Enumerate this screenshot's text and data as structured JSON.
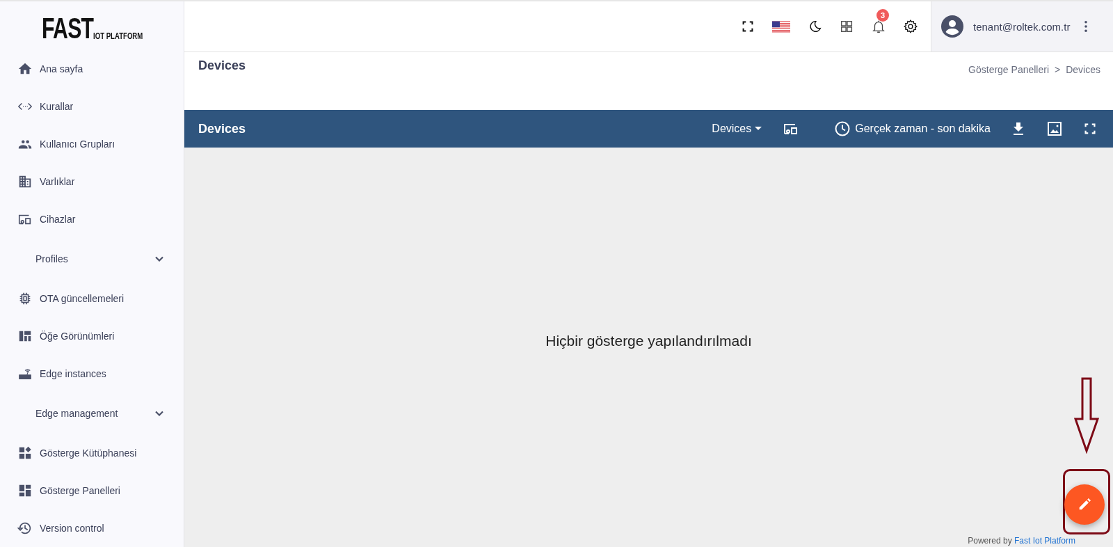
{
  "logo": {
    "title": "FAST",
    "subtitle": "IOT PLATFORM"
  },
  "sidebar": {
    "items": [
      {
        "label": "Ana sayfa",
        "kind": "link"
      },
      {
        "label": "Kurallar",
        "kind": "link"
      },
      {
        "label": "Kullanıcı Grupları",
        "kind": "link"
      },
      {
        "label": "Varlıklar",
        "kind": "link"
      },
      {
        "label": "Cihazlar",
        "kind": "link"
      },
      {
        "label": "Profiles",
        "kind": "group",
        "expanded": false
      },
      {
        "label": "OTA güncellemeleri",
        "kind": "link"
      },
      {
        "label": "Öğe Görünümleri",
        "kind": "link"
      },
      {
        "label": "Edge instances",
        "kind": "link"
      },
      {
        "label": "Edge management",
        "kind": "group",
        "expanded": false
      },
      {
        "label": "Gösterge Kütüphanesi",
        "kind": "link"
      },
      {
        "label": "Gösterge Panelleri",
        "kind": "link"
      },
      {
        "label": "Version control",
        "kind": "link"
      }
    ]
  },
  "topbar": {
    "notifications": {
      "count": "3"
    },
    "user": {
      "email": "tenant@roltek.com.tr"
    }
  },
  "page": {
    "title": "Devices",
    "breadcrumb": [
      "Gösterge Panelleri",
      "Devices"
    ],
    "separator": ">"
  },
  "dashboard_toolbar": {
    "title": "Devices",
    "state_select": "Devices",
    "timewindow": "Gerçek zaman - son dakika"
  },
  "empty_message": "Hiçbir gösterge yapılandırılmadı",
  "footer": {
    "prefix": "Powered by",
    "link": "Fast Iot Platform"
  }
}
